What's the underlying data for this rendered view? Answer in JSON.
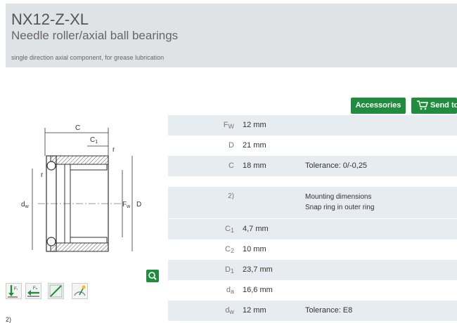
{
  "header": {
    "title": "NX12-Z-XL",
    "subtitle": "Needle roller/axial ball bearings",
    "description": "single direction axial component, for grease lubrication"
  },
  "buttons": {
    "accessories": "Accessories",
    "send_to": "Send to"
  },
  "drawing": {
    "label_c": "C",
    "label_c1": "C",
    "label_c1_sub": "1",
    "label_r_top": "r",
    "label_r_left": "r",
    "label_dw": "d",
    "label_dw_sub": "w",
    "label_fw": "F",
    "label_fw_sub": "w",
    "label_d": "D"
  },
  "tools": {
    "t1": "F",
    "t1_sub": "r",
    "t2": "F",
    "t2_sub": "a"
  },
  "footnote_cut": "2)",
  "table_top": [
    {
      "label": "F",
      "label_sub": "W",
      "value": "12  mm",
      "note": ""
    },
    {
      "label": "D",
      "label_sub": "",
      "value": "21  mm",
      "note": ""
    },
    {
      "label": "C",
      "label_sub": "",
      "value": "18  mm",
      "note": "Tolerance: 0/-0,25"
    }
  ],
  "mounting": {
    "label": "2)",
    "line1": "Mounting dimensions",
    "line2": "Snap ring in outer ring"
  },
  "table_bottom": [
    {
      "label": "C",
      "label_sub": "1",
      "value": "4,7  mm",
      "note": ""
    },
    {
      "label": "C",
      "label_sub": "2",
      "value": "10  mm",
      "note": ""
    },
    {
      "label": "D",
      "label_sub": "1",
      "value": "23,7  mm",
      "note": ""
    },
    {
      "label": "d",
      "label_sub": "a",
      "value": "16,6  mm",
      "note": ""
    },
    {
      "label": "d",
      "label_sub": "w",
      "value": "12  mm",
      "note": "Tolerance: E8"
    }
  ],
  "colors": {
    "accent": "#1f8d3d",
    "header_bg": "#dfe3e6",
    "row_bg": "#e6ecf0"
  }
}
